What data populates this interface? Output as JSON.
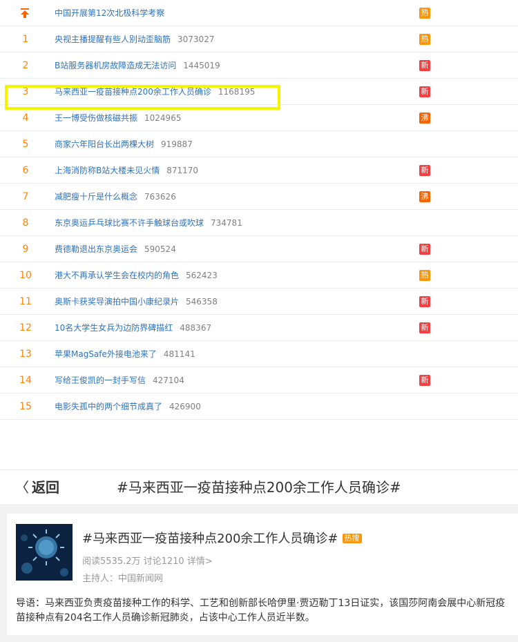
{
  "hot_list": [
    {
      "rank": "",
      "pinned": true,
      "title": "中国开展第12次北极科学考察",
      "heat": "",
      "badge": "热",
      "badge_type": "hot"
    },
    {
      "rank": "1",
      "title": "央视主播提醒有些人别动歪脑筋",
      "heat": "3073027",
      "badge": "热",
      "badge_type": "hot"
    },
    {
      "rank": "2",
      "title": "B站服务器机房故障造成无法访问",
      "heat": "1445019",
      "badge": "新",
      "badge_type": "new"
    },
    {
      "rank": "3",
      "title": "马来西亚一疫苗接种点200余工作人员确诊",
      "heat": "1168195",
      "badge": "新",
      "badge_type": "new"
    },
    {
      "rank": "4",
      "title": "王一博受伤做核磁共振",
      "heat": "1024965",
      "badge": "沸",
      "badge_type": "boil"
    },
    {
      "rank": "5",
      "title": "商家六年阳台长出两棵大树",
      "heat": "919887",
      "badge": "",
      "badge_type": ""
    },
    {
      "rank": "6",
      "title": "上海消防称B站大楼未见火情",
      "heat": "871170",
      "badge": "新",
      "badge_type": "new"
    },
    {
      "rank": "7",
      "title": "减肥瘦十斤是什么概念",
      "heat": "763626",
      "badge": "沸",
      "badge_type": "boil"
    },
    {
      "rank": "8",
      "title": "东京奥运乒乓球比赛不许手触球台或吹球",
      "heat": "734781",
      "badge": "",
      "badge_type": ""
    },
    {
      "rank": "9",
      "title": "费德勒退出东京奥运会",
      "heat": "590524",
      "badge": "新",
      "badge_type": "new"
    },
    {
      "rank": "10",
      "title": "港大不再承认学生会在校内的角色",
      "heat": "562423",
      "badge": "热",
      "badge_type": "hot"
    },
    {
      "rank": "11",
      "title": "奥斯卡获奖导演拍中国小康纪录片",
      "heat": "546358",
      "badge": "新",
      "badge_type": "new"
    },
    {
      "rank": "12",
      "title": "10名大学生女兵为边防界碑描红",
      "heat": "488367",
      "badge": "新",
      "badge_type": "new"
    },
    {
      "rank": "13",
      "title": "苹果MagSafe外接电池来了",
      "heat": "481141",
      "badge": "",
      "badge_type": ""
    },
    {
      "rank": "14",
      "title": "写给王俊凯的一封手写信",
      "heat": "427104",
      "badge": "新",
      "badge_type": "new"
    },
    {
      "rank": "15",
      "title": "电影失孤中的两个细节成真了",
      "heat": "426900",
      "badge": "",
      "badge_type": ""
    }
  ],
  "topbar": {
    "back_chevron": "〈",
    "back_label": "返回",
    "title": "#马来西亚一疫苗接种点200余工作人员确诊#"
  },
  "topic_card": {
    "thumb_icon": "virus-image",
    "title": "#马来西亚一疫苗接种点200余工作人员确诊#",
    "tag": "热搜",
    "stats": "阅读5535.2万 讨论1210 详情>",
    "host": "主持人：中国新闻网",
    "intro": "导语：马来西亚负责疫苗接种工作的科学、工艺和创新部长哈伊里·贾迈勒丁13日证实，该国莎阿南会展中心新冠疫苗接种点有204名工作人员确诊新冠肺炎，占该中心工作人员近半数。"
  },
  "colors": {
    "rank": "#ff8200",
    "link": "#2d73c0",
    "badge_hot": "#ff9406",
    "badge_new": "#f83e3e",
    "badge_boil": "#f86400",
    "highlight": "#f5f500"
  }
}
